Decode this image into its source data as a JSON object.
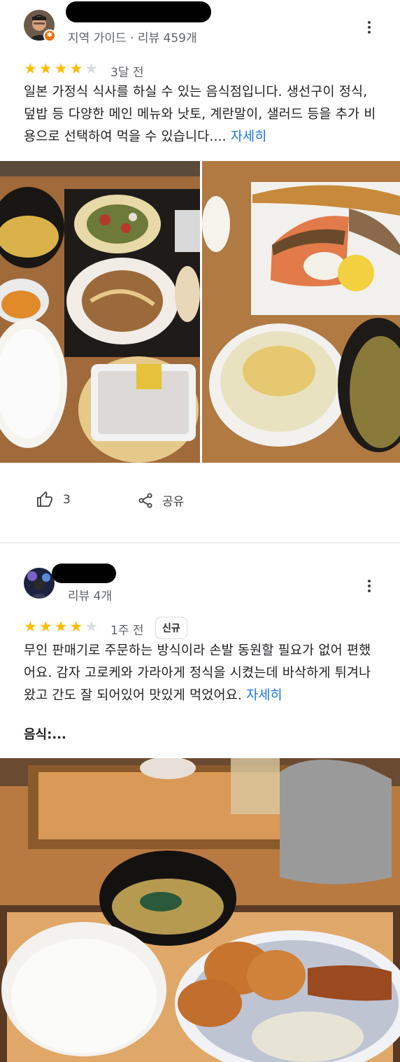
{
  "reviews": [
    {
      "meta": "지역 가이드 · 리뷰 459개",
      "rating": 4,
      "age": "3달 전",
      "text": "일본 가정식 식사를 하실 수 있는 음식점입니다. 생선구이 정식, 덮밥 등 다양한 메인 메뉴와 낫토, 계란말이, 샐러드 등을 추가 비용으로 선택하여 먹을 수 있습니다....",
      "more_label": "자세히",
      "like_count": "3",
      "share_label": "공유"
    },
    {
      "meta": "리뷰 4개",
      "rating": 4,
      "age": "1주 전",
      "new_label": "신규",
      "text": "무인 판매기로 주문하는 방식이라 손발 동원할 필요가 없어 편했어요. 감자 고로케와 가라아게 정식을 시켰는데 바삭하게 튀겨나왔고 간도 잘 되어있어 맛있게 먹었어요.",
      "more_label": "자세히",
      "food_label": "음식:..."
    }
  ],
  "colors": {
    "star": "#fbbc04",
    "star_empty": "#dadce0",
    "link": "#1a73e8",
    "local_guide_badge": "#e8710a"
  },
  "icons": [
    "more-vert-icon",
    "thumb-up-icon",
    "share-icon",
    "star-icon",
    "local-guide-badge-icon"
  ]
}
